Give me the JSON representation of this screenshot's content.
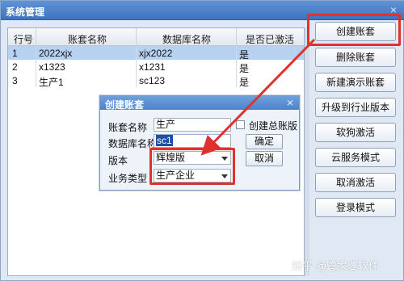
{
  "window": {
    "title": "系统管理",
    "close": "×"
  },
  "grid": {
    "headers": [
      "行号",
      "账套名称",
      "数据库名称",
      "是否已激活"
    ],
    "rows": [
      [
        "1",
        "2022xjx",
        "xjx2022",
        "是"
      ],
      [
        "2",
        "x1323",
        "x1231",
        "是"
      ],
      [
        "3",
        "生产1",
        "sc123",
        "是"
      ]
    ]
  },
  "buttons": [
    "创建账套",
    "删除账套",
    "新建演示账套",
    "升级到行业版本",
    "软狗激活",
    "云服务模式",
    "取消激活",
    "登录模式"
  ],
  "dialog": {
    "title": "创建账套",
    "close": "⨯",
    "labels": {
      "name": "账套名称",
      "db": "数据库名称",
      "version": "版本",
      "biz": "业务类型"
    },
    "values": {
      "name": "生产",
      "db": "sc1",
      "version": "辉煌版",
      "biz": "生产企业"
    },
    "checkbox_label": "创建总账版",
    "ok": "确定",
    "cancel": "取消"
  },
  "colors": {
    "highlight": "#e0312f",
    "selected_row": "#b7d2f0",
    "titlebar": "#4a7fc7"
  },
  "watermark": "知乎 @管家婆软件"
}
